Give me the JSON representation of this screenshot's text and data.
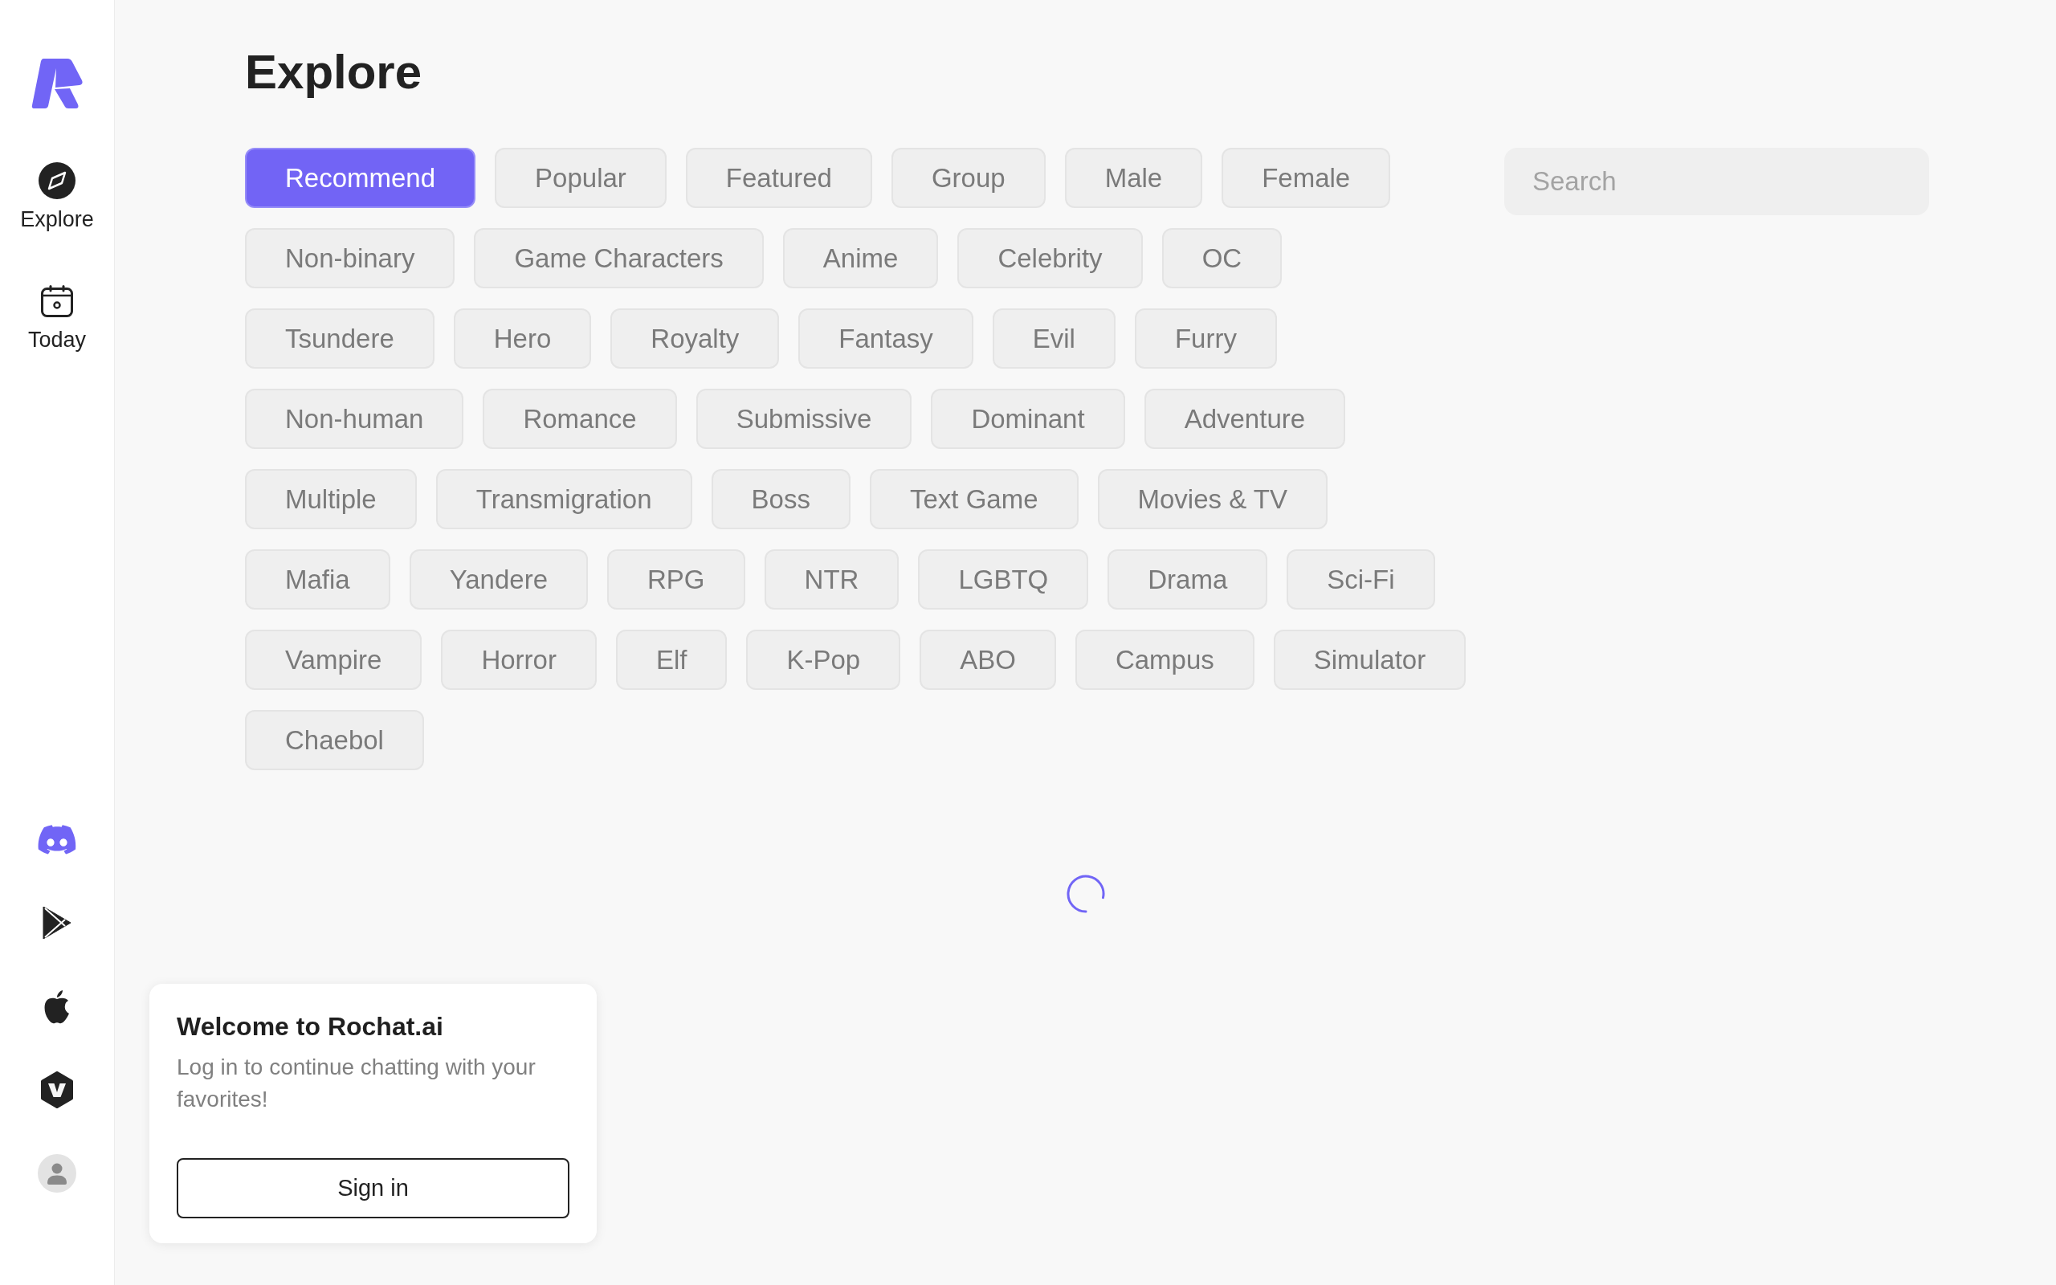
{
  "sidebar": {
    "nav": [
      {
        "label": "Explore",
        "kind": "compass",
        "selected": true
      },
      {
        "label": "Today",
        "kind": "calendar",
        "selected": false
      }
    ]
  },
  "page": {
    "title": "Explore"
  },
  "categories": [
    {
      "label": "Recommend",
      "selected": true
    },
    {
      "label": "Popular",
      "selected": false
    },
    {
      "label": "Featured",
      "selected": false
    },
    {
      "label": "Group",
      "selected": false
    },
    {
      "label": "Male",
      "selected": false
    },
    {
      "label": "Female",
      "selected": false
    },
    {
      "label": "Non-binary",
      "selected": false
    },
    {
      "label": "Game Characters",
      "selected": false
    },
    {
      "label": "Anime",
      "selected": false
    },
    {
      "label": "Celebrity",
      "selected": false
    },
    {
      "label": "OC",
      "selected": false
    },
    {
      "label": "Tsundere",
      "selected": false
    },
    {
      "label": "Hero",
      "selected": false
    },
    {
      "label": "Royalty",
      "selected": false
    },
    {
      "label": "Fantasy",
      "selected": false
    },
    {
      "label": "Evil",
      "selected": false
    },
    {
      "label": "Furry",
      "selected": false
    },
    {
      "label": "Non-human",
      "selected": false
    },
    {
      "label": "Romance",
      "selected": false
    },
    {
      "label": "Submissive",
      "selected": false
    },
    {
      "label": "Dominant",
      "selected": false
    },
    {
      "label": "Adventure",
      "selected": false
    },
    {
      "label": "Multiple",
      "selected": false
    },
    {
      "label": "Transmigration",
      "selected": false
    },
    {
      "label": "Boss",
      "selected": false
    },
    {
      "label": "Text Game",
      "selected": false
    },
    {
      "label": "Movies & TV",
      "selected": false
    },
    {
      "label": "Mafia",
      "selected": false
    },
    {
      "label": "Yandere",
      "selected": false
    },
    {
      "label": "RPG",
      "selected": false
    },
    {
      "label": "NTR",
      "selected": false
    },
    {
      "label": "LGBTQ",
      "selected": false
    },
    {
      "label": "Drama",
      "selected": false
    },
    {
      "label": "Sci-Fi",
      "selected": false
    },
    {
      "label": "Vampire",
      "selected": false
    },
    {
      "label": "Horror",
      "selected": false
    },
    {
      "label": "Elf",
      "selected": false
    },
    {
      "label": "K-Pop",
      "selected": false
    },
    {
      "label": "ABO",
      "selected": false
    },
    {
      "label": "Campus",
      "selected": false
    },
    {
      "label": "Simulator",
      "selected": false
    },
    {
      "label": "Chaebol",
      "selected": false
    }
  ],
  "search": {
    "placeholder": "Search"
  },
  "feed": {
    "loading": true
  },
  "welcome_card": {
    "title": "Welcome to Rochat.ai",
    "message": "Log in to continue chatting with your favorites!",
    "button": "Sign in"
  }
}
